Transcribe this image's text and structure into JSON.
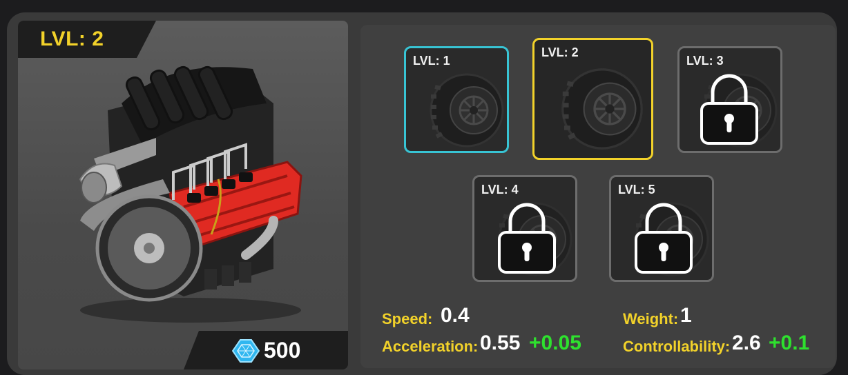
{
  "part": {
    "level_label": "LVL: 2",
    "price": "500",
    "price_icon": "gem-icon"
  },
  "upgrades": [
    {
      "label": "LVL: 1",
      "state": "unlocked"
    },
    {
      "label": "LVL: 2",
      "state": "selected"
    },
    {
      "label": "LVL: 3",
      "state": "locked"
    },
    {
      "label": "LVL: 4",
      "state": "locked"
    },
    {
      "label": "LVL: 5",
      "state": "locked"
    }
  ],
  "stats": {
    "speed": {
      "label": "Speed:",
      "value": "0.4"
    },
    "acceleration": {
      "label": "Acceleration:",
      "value": "0.55",
      "bonus": "+0.05"
    },
    "weight": {
      "label": "Weight:",
      "value": "1"
    },
    "controllability": {
      "label": "Controllability:",
      "value": "2.6",
      "bonus": "+0.1"
    }
  },
  "colors": {
    "accent_yellow": "#f2d22a",
    "unlocked_cyan": "#38c4d4",
    "bonus_green": "#2ee12e"
  }
}
